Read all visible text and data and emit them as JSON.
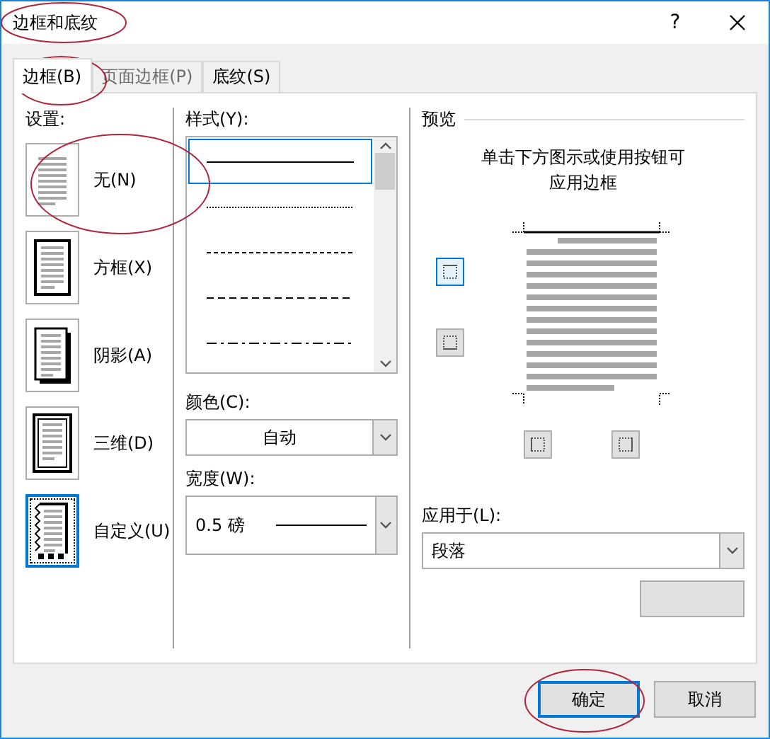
{
  "window": {
    "title": "边框和底纹",
    "help": "?"
  },
  "tabs": [
    {
      "label": "边框(B)",
      "selected": true
    },
    {
      "label": "页面边框(P)",
      "selected": false
    },
    {
      "label": "底纹(S)",
      "selected": false
    }
  ],
  "settings": {
    "label": "设置:",
    "items": [
      {
        "label": "无(N)",
        "kind": "none",
        "selected": false
      },
      {
        "label": "方框(X)",
        "kind": "box",
        "selected": false
      },
      {
        "label": "阴影(A)",
        "kind": "shadow",
        "selected": false
      },
      {
        "label": "三维(D)",
        "kind": "three-d",
        "selected": false
      },
      {
        "label": "自定义(U)",
        "kind": "custom",
        "selected": true
      }
    ]
  },
  "style": {
    "label": "样式(Y):",
    "lines": [
      {
        "kind": "solid",
        "selected": true
      },
      {
        "kind": "dotted",
        "selected": false
      },
      {
        "kind": "dashed-fine",
        "selected": false
      },
      {
        "kind": "dashed",
        "selected": false
      },
      {
        "kind": "dash-dot",
        "selected": false
      }
    ]
  },
  "color": {
    "label": "颜色(C):",
    "value": "自动"
  },
  "width": {
    "label": "宽度(W):",
    "value": "0.5 磅"
  },
  "preview": {
    "label": "预览",
    "hint": "单击下方图示或使用按钮可应用边框",
    "border_buttons": [
      {
        "kind": "top",
        "on": true
      },
      {
        "kind": "bottom",
        "on": false
      },
      {
        "kind": "left",
        "on": false
      },
      {
        "kind": "right",
        "on": false
      }
    ]
  },
  "apply_to": {
    "label": "应用于(L):",
    "value": "段落"
  },
  "buttons": [
    {
      "label": "确定",
      "default": true
    },
    {
      "label": "取消",
      "default": false
    }
  ]
}
